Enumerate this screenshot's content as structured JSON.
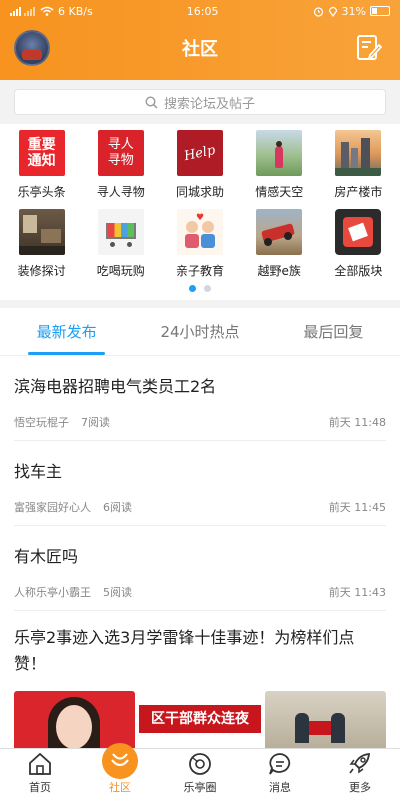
{
  "status_bar": {
    "network": "6 KB/s",
    "time": "16:05",
    "battery": "31%",
    "battery_level": 0.31
  },
  "header": {
    "title": "社区"
  },
  "search": {
    "placeholder": "搜索论坛及帖子"
  },
  "categories": [
    {
      "label": "乐亭头条",
      "icon": "headline-news-icon",
      "text": [
        "重要",
        "通知"
      ]
    },
    {
      "label": "寻人寻物",
      "icon": "lost-and-found-icon",
      "text": [
        "寻人",
        "寻物"
      ]
    },
    {
      "label": "同城求助",
      "icon": "help-icon",
      "text": [
        "Help"
      ]
    },
    {
      "label": "情感天空",
      "icon": "emotion-icon"
    },
    {
      "label": "房产楼市",
      "icon": "real-estate-icon"
    },
    {
      "label": "装修探讨",
      "icon": "decoration-icon"
    },
    {
      "label": "吃喝玩购",
      "icon": "shopping-cart-icon"
    },
    {
      "label": "亲子教育",
      "icon": "parenting-icon"
    },
    {
      "label": "越野e族",
      "icon": "offroad-icon"
    },
    {
      "label": "全部版块",
      "icon": "all-boards-icon"
    }
  ],
  "tabs": [
    {
      "label": "最新发布",
      "active": true
    },
    {
      "label": "24小时热点",
      "active": false
    },
    {
      "label": "最后回复",
      "active": false
    }
  ],
  "posts": [
    {
      "title": "滨海电器招聘电气类员工2名",
      "author": "悟空玩棍子",
      "reads": "7阅读",
      "time": "前天 11:48"
    },
    {
      "title": "找车主",
      "author": "富强家园好心人",
      "reads": "6阅读",
      "time": "前天 11:45"
    },
    {
      "title": "有木匠吗",
      "author": "人称乐亭小霸王",
      "reads": "5阅读",
      "time": "前天 11:43"
    },
    {
      "title": "乐亭2事迹入选3月学雷锋十佳事迹！为榜样们点赞！",
      "banner_text": "区干部群众连夜"
    }
  ],
  "bottom_nav": [
    {
      "label": "首页",
      "icon": "home-icon",
      "active": false
    },
    {
      "label": "社区",
      "icon": "community-icon",
      "active": true
    },
    {
      "label": "乐亭圈",
      "icon": "circle-icon",
      "active": false
    },
    {
      "label": "消息",
      "icon": "message-icon",
      "active": false
    },
    {
      "label": "更多",
      "icon": "rocket-icon",
      "active": false
    }
  ],
  "colors": {
    "accent": "#f7931e",
    "tab_active": "#1e9ef5"
  }
}
